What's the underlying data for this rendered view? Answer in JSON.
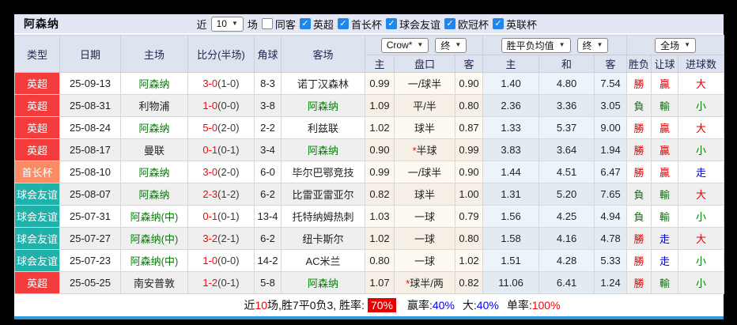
{
  "title": "阿森纳",
  "icons": {
    "chevron_down": "▼",
    "checkmark": "✓"
  },
  "topbar": {
    "near_label": "近",
    "games_select": "10",
    "games_suffix": "场"
  },
  "filters": [
    {
      "label": "同客",
      "checked": false
    },
    {
      "label": "英超",
      "checked": true
    },
    {
      "label": "首长杯",
      "checked": true
    },
    {
      "label": "球会友谊",
      "checked": true
    },
    {
      "label": "欧冠杯",
      "checked": true
    },
    {
      "label": "英联杯",
      "checked": true
    }
  ],
  "selects": {
    "crown": "Crow*",
    "crown_state": "终",
    "europe": "胜平负均值",
    "europe_state": "终",
    "scope": "全场"
  },
  "columns": {
    "type": "类型",
    "date": "日期",
    "home": "主场",
    "score": "比分(半场)",
    "corner": "角球",
    "away": "客场",
    "asia_home": "主",
    "asia_handicap": "盘口",
    "asia_away": "客",
    "euro_home": "主",
    "euro_draw": "和",
    "euro_away": "客",
    "wl": "胜负",
    "give": "让球",
    "goals": "进球数"
  },
  "rows": [
    {
      "type": "英超",
      "date": "25-09-13",
      "home": "阿森纳",
      "score": "3-0",
      "half": "(1-0)",
      "corner": "8-3",
      "away": "诺丁汉森林",
      "a_home": "0.99",
      "star": "",
      "handicap": "一/球半",
      "a_away": "0.90",
      "e_home": "1.40",
      "e_draw": "4.80",
      "e_away": "7.54",
      "wl": "勝",
      "give": "贏",
      "goals": "大"
    },
    {
      "type": "英超",
      "date": "25-08-31",
      "home": "利物浦",
      "score": "1-0",
      "half": "(0-0)",
      "corner": "3-8",
      "away": "阿森纳",
      "a_home": "1.09",
      "star": "",
      "handicap": "平/半",
      "a_away": "0.80",
      "e_home": "2.36",
      "e_draw": "3.36",
      "e_away": "3.05",
      "wl": "負",
      "give": "輸",
      "goals": "小"
    },
    {
      "type": "英超",
      "date": "25-08-24",
      "home": "阿森纳",
      "score": "5-0",
      "half": "(2-0)",
      "corner": "2-2",
      "away": "利兹联",
      "a_home": "1.02",
      "star": "",
      "handicap": "球半",
      "a_away": "0.87",
      "e_home": "1.33",
      "e_draw": "5.37",
      "e_away": "9.00",
      "wl": "勝",
      "give": "贏",
      "goals": "大"
    },
    {
      "type": "英超",
      "date": "25-08-17",
      "home": "曼联",
      "score": "0-1",
      "half": "(0-1)",
      "corner": "3-4",
      "away": "阿森纳",
      "a_home": "0.90",
      "star": "*",
      "handicap": "半球",
      "a_away": "0.99",
      "e_home": "3.83",
      "e_draw": "3.64",
      "e_away": "1.94",
      "wl": "勝",
      "give": "贏",
      "goals": "小"
    },
    {
      "type": "首长杯",
      "date": "25-08-10",
      "home": "阿森纳",
      "score": "3-0",
      "half": "(2-0)",
      "corner": "6-0",
      "away": "毕尔巴鄂竞技",
      "a_home": "0.99",
      "star": "",
      "handicap": "一/球半",
      "a_away": "0.90",
      "e_home": "1.44",
      "e_draw": "4.51",
      "e_away": "6.47",
      "wl": "勝",
      "give": "贏",
      "goals": "走"
    },
    {
      "type": "球会友谊",
      "date": "25-08-07",
      "home": "阿森纳",
      "score": "2-3",
      "half": "(1-2)",
      "corner": "6-2",
      "away": "比雷亚雷亚尔",
      "a_home": "0.82",
      "star": "",
      "handicap": "球半",
      "a_away": "1.00",
      "e_home": "1.31",
      "e_draw": "5.20",
      "e_away": "7.65",
      "wl": "負",
      "give": "輸",
      "goals": "大"
    },
    {
      "type": "球会友谊",
      "date": "25-07-31",
      "home": "阿森纳(中)",
      "score": "0-1",
      "half": "(0-1)",
      "corner": "13-4",
      "away": "托特纳姆热刺",
      "a_home": "1.03",
      "star": "",
      "handicap": "一球",
      "a_away": "0.79",
      "e_home": "1.56",
      "e_draw": "4.25",
      "e_away": "4.94",
      "wl": "負",
      "give": "輸",
      "goals": "小"
    },
    {
      "type": "球会友谊",
      "date": "25-07-27",
      "home": "阿森纳(中)",
      "score": "3-2",
      "half": "(2-1)",
      "corner": "6-2",
      "away": "纽卡斯尔",
      "a_home": "1.02",
      "star": "",
      "handicap": "一球",
      "a_away": "0.80",
      "e_home": "1.58",
      "e_draw": "4.16",
      "e_away": "4.78",
      "wl": "勝",
      "give": "走",
      "goals": "大"
    },
    {
      "type": "球会友谊",
      "date": "25-07-23",
      "home": "阿森纳(中)",
      "score": "1-0",
      "half": "(0-0)",
      "corner": "14-2",
      "away": "AC米兰",
      "a_home": "0.80",
      "star": "",
      "handicap": "一球",
      "a_away": "1.02",
      "e_home": "1.51",
      "e_draw": "4.28",
      "e_away": "5.33",
      "wl": "勝",
      "give": "走",
      "goals": "小"
    },
    {
      "type": "英超",
      "date": "25-05-25",
      "home": "南安普敦",
      "score": "1-2",
      "half": "(0-1)",
      "corner": "5-8",
      "away": "阿森纳",
      "a_home": "1.07",
      "star": "*",
      "handicap": "球半/两",
      "a_away": "0.82",
      "e_home": "11.06",
      "e_draw": "6.41",
      "e_away": "1.24",
      "wl": "勝",
      "give": "輸",
      "goals": "小"
    }
  ],
  "summary": {
    "prefix": "近",
    "count": "10",
    "record": "场,胜7平0负3, 胜率:",
    "win_rate": "70%",
    "seg2_label": "赢率:",
    "seg2_value": "40%",
    "seg3_label": "大:",
    "seg3_value": "40%",
    "seg4_label": "单率:",
    "seg4_value": "100%"
  },
  "type_colors": {
    "英超": "#f43c3c",
    "首长杯": "#fa8b64",
    "球会友谊": "#20b2aa"
  },
  "result_colors": {
    "勝": "#e00000",
    "負": "#008000",
    "贏": "#e00000",
    "輸": "#008000",
    "走": "#0000cc",
    "大": "#e00000",
    "小": "#008000"
  },
  "highlight_team": "阿森纳",
  "colors": {
    "team_green": "#008000"
  }
}
